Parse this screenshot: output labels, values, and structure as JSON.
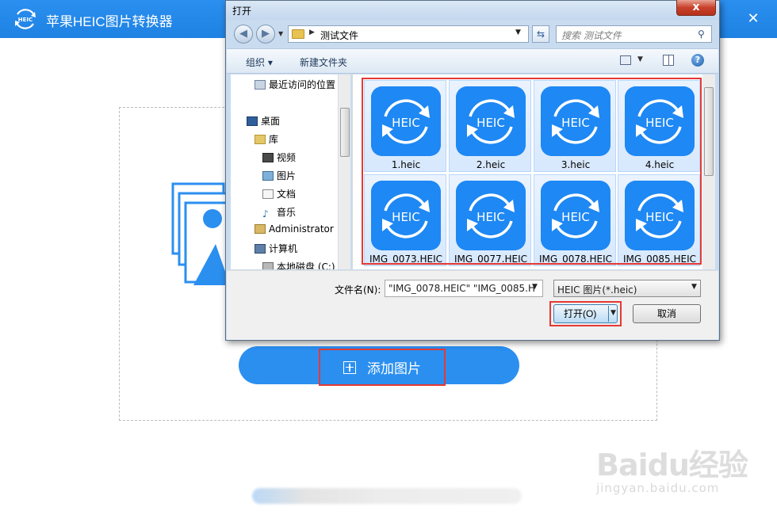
{
  "app": {
    "title": "苹果HEIC图片转换器",
    "logo_text": "HEIC",
    "add_button_label": "添加图片",
    "accent_color": "#2b8ff0"
  },
  "watermark": {
    "main": "Baidu经验",
    "sub": "jingyan.baidu.com"
  },
  "dialog": {
    "title": "打开",
    "close_glyph": "x",
    "address": {
      "path": "测试文件"
    },
    "search": {
      "placeholder": "搜索 测试文件"
    },
    "toolbar": {
      "organize": "组织 ▾",
      "new_folder": "新建文件夹",
      "help": "?"
    },
    "nav_items": [
      {
        "label": "最近访问的位置",
        "icon": "recent-icon"
      },
      {
        "label": "桌面",
        "icon": "desktop-icon"
      },
      {
        "label": "库",
        "icon": "library-icon"
      },
      {
        "label": "视频",
        "icon": "video-icon"
      },
      {
        "label": "图片",
        "icon": "pictures-icon"
      },
      {
        "label": "文档",
        "icon": "documents-icon"
      },
      {
        "label": "音乐",
        "icon": "music-icon"
      },
      {
        "label": "Administrator",
        "icon": "user-icon"
      },
      {
        "label": "计算机",
        "icon": "computer-icon"
      },
      {
        "label": "本地磁盘 (C:)",
        "icon": "drive-icon"
      }
    ],
    "files": [
      {
        "name": "1.heic",
        "icon_text": "HEIC"
      },
      {
        "name": "2.heic",
        "icon_text": "HEIC"
      },
      {
        "name": "3.heic",
        "icon_text": "HEIC"
      },
      {
        "name": "4.heic",
        "icon_text": "HEIC"
      },
      {
        "name": "IMG_0073.HEIC",
        "icon_text": "HEIC"
      },
      {
        "name": "IMG_0077.HEIC",
        "icon_text": "HEIC"
      },
      {
        "name": "IMG_0078.HEIC",
        "icon_text": "HEIC"
      },
      {
        "name": "IMG_0085.HEIC",
        "icon_text": "HEIC"
      }
    ],
    "filename_label": "文件名(N):",
    "filename_value": "\"IMG_0078.HEIC\" \"IMG_0085.H",
    "filetype_value": "HEIC 图片(*.heic)",
    "open_label": "打开(O)",
    "cancel_label": "取消"
  }
}
